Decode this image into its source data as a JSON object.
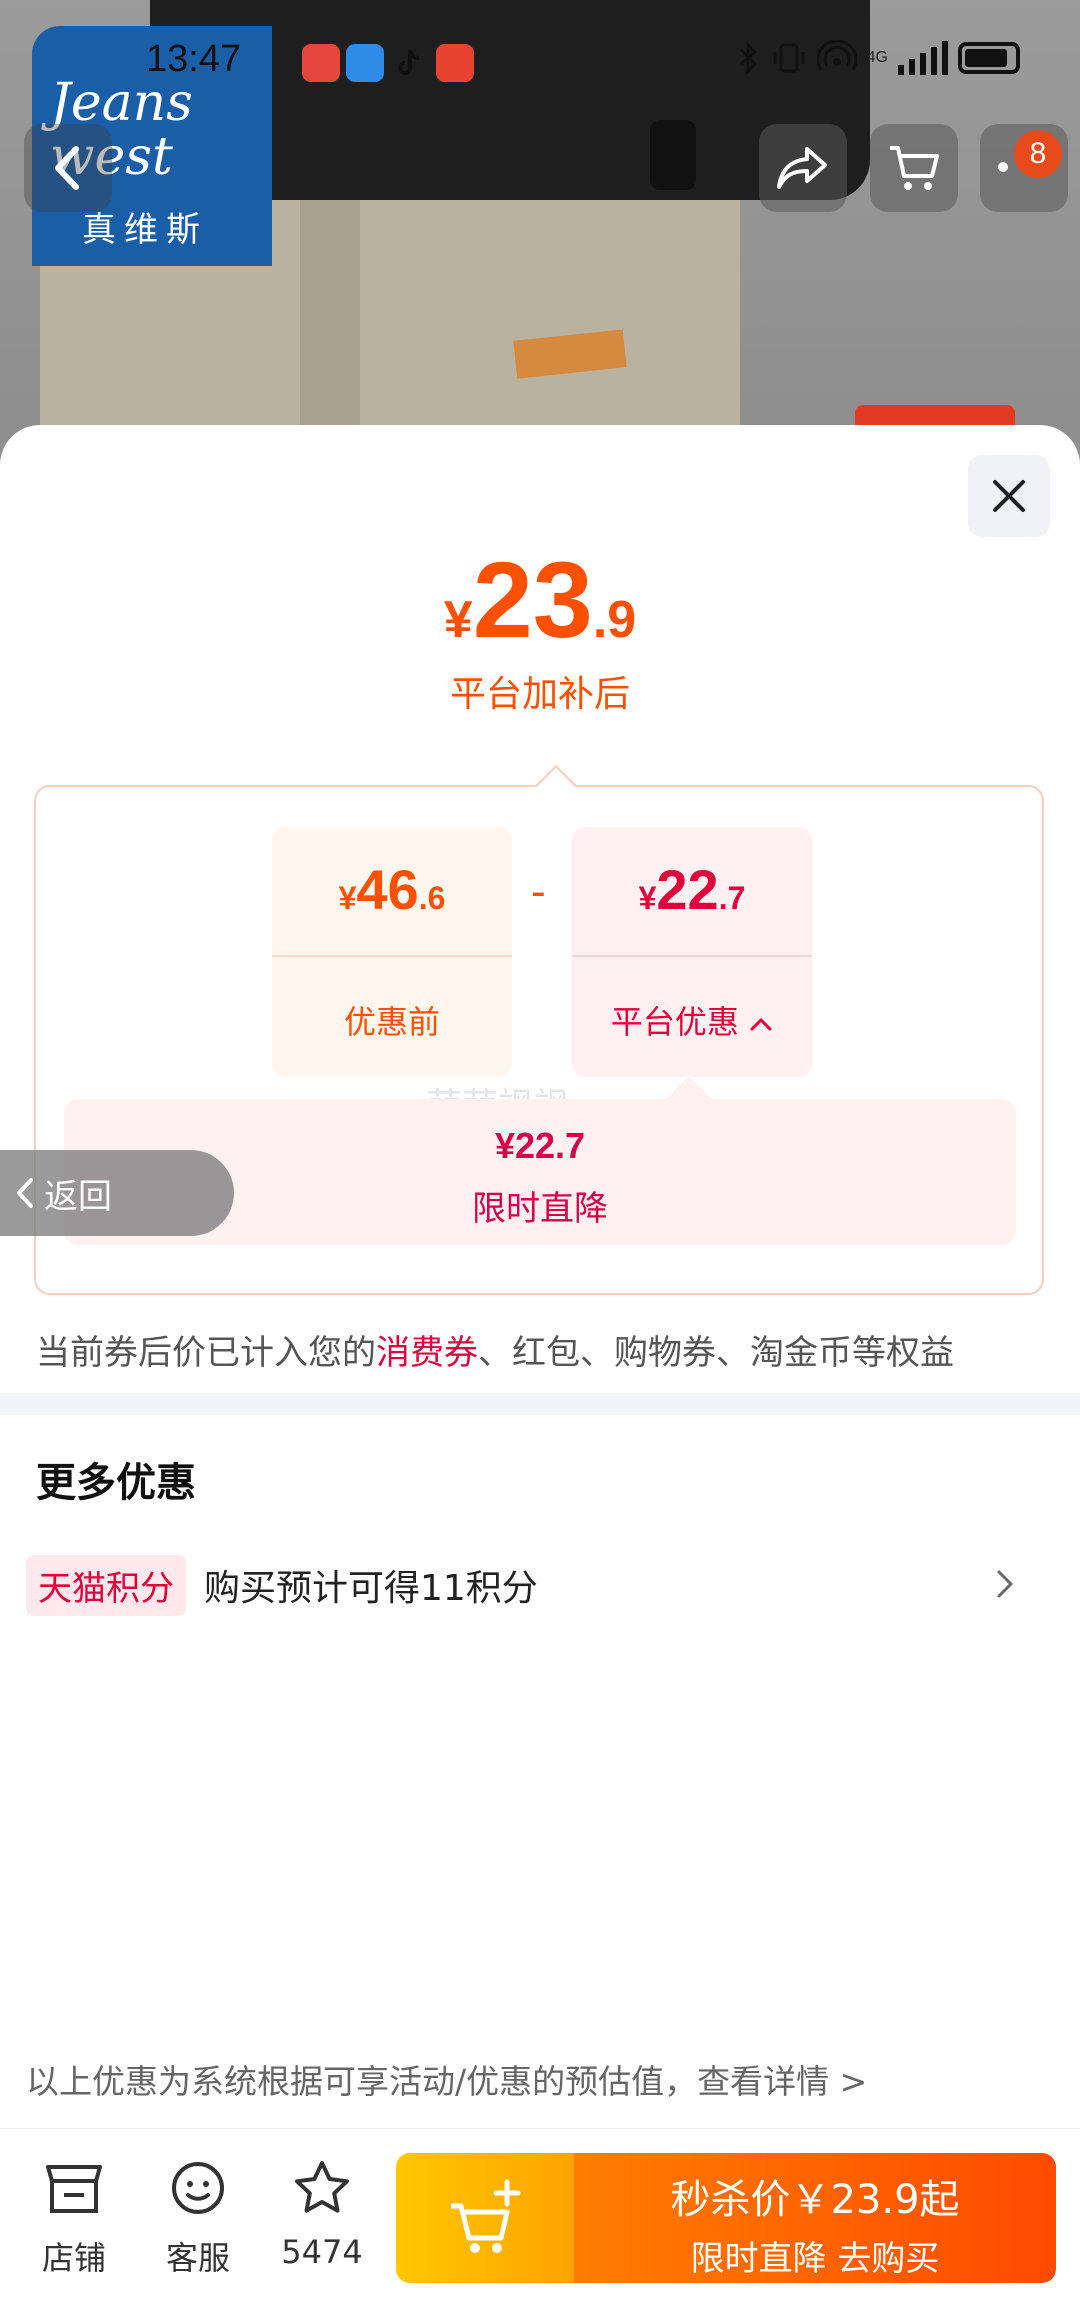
{
  "status_bar": {
    "time": "13:47",
    "network": "4G"
  },
  "brand": {
    "logo_en_line1": "Jeans",
    "logo_en_line2": "west",
    "logo_cn": "真维斯"
  },
  "header": {
    "badge_count": "8"
  },
  "price": {
    "currency": "¥",
    "integer": "23",
    "decimal": ".9",
    "caption": "平台加补后"
  },
  "breakdown": {
    "before": {
      "currency": "¥",
      "integer": "46",
      "decimal": ".6",
      "label": "优惠前"
    },
    "minus": "-",
    "discount": {
      "currency": "¥",
      "integer": "22",
      "decimal": ".7",
      "label": "平台优惠"
    },
    "detail_amount": "¥22.7",
    "detail_label": "限时直降",
    "watermark": "萌萌飒飒"
  },
  "note": {
    "prefix": "当前券后价已计入您的",
    "highlight": "消费券",
    "suffix": "、红包、购物券、淘金币等权益"
  },
  "more": {
    "title": "更多优惠",
    "tag": "天猫积分",
    "text": "购买预计可得11积分"
  },
  "back_button": {
    "label": "返回"
  },
  "disclaimer": "以上优惠为系统根据可享活动/优惠的预估值，查看详情 >",
  "bottom_bar": {
    "store_label": "店铺",
    "service_label": "客服",
    "favorite_count": "5474",
    "buy_line1": "秒杀价￥23.9起",
    "buy_line2": "限时直降  去购买"
  },
  "colors": {
    "accent_orange": "#ff5000",
    "accent_red": "#e0003b",
    "brand_blue": "#1a5ea8"
  }
}
